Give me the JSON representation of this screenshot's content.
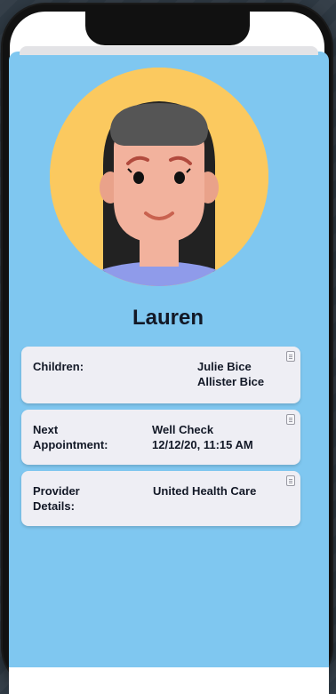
{
  "profile": {
    "name": "Lauren"
  },
  "cards": [
    {
      "label": "Children:",
      "values": [
        "Julie Bice",
        "Allister Bice"
      ],
      "edit_icon": "edit-icon"
    },
    {
      "label": "Next Appointment:",
      "label_lines": [
        "Next",
        "Appointment:"
      ],
      "values": [
        "Well Check",
        "12/12/20, 11:15 AM"
      ],
      "edit_icon": "edit-icon"
    },
    {
      "label": "Provider Details:",
      "label_lines": [
        "Provider",
        "Details:"
      ],
      "values": [
        "United Health Care"
      ],
      "edit_icon": "edit-icon"
    }
  ],
  "colors": {
    "app_background": "#7fc7f0",
    "avatar_background": "#fbc95f",
    "card_background": "#eeeef4",
    "text": "#121826"
  }
}
